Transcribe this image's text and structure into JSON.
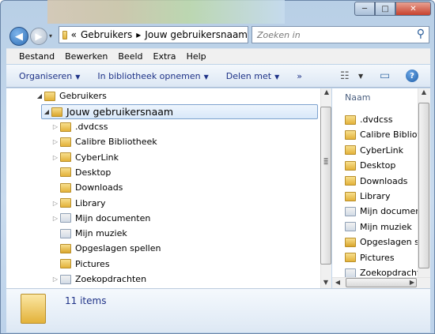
{
  "window": {
    "controls": {
      "minimize": "─",
      "maximize": "□",
      "close": "✕"
    }
  },
  "nav": {
    "back_icon": "◀",
    "forward_icon": "▶",
    "recent_icon": "▾"
  },
  "address": {
    "chevron": "«",
    "crumbs": [
      "Gebruikers",
      "Jouw gebruikersnaam"
    ],
    "separator": "▸"
  },
  "search": {
    "placeholder": "Zoeken in",
    "icon": "search-icon",
    "glyph": "⚲"
  },
  "menu": [
    "Bestand",
    "Bewerken",
    "Beeld",
    "Extra",
    "Help"
  ],
  "commands": {
    "organize": "Organiseren",
    "include": "In bibliotheek opnemen",
    "share": "Delen met",
    "more": "»",
    "view_icon": "☷",
    "pane_icon": "▭",
    "help_icon": "?"
  },
  "tree": {
    "root": "Gebruikers",
    "user": "Jouw gebruikersnaam",
    "children": [
      ".dvdcss",
      "Calibre Bibliotheek",
      "CyberLink",
      "Desktop",
      "Downloads",
      "Library",
      "Mijn documenten",
      "Mijn muziek",
      "Opgeslagen spellen",
      "Pictures",
      "Zoekopdrachten"
    ]
  },
  "list": {
    "header": "Naam",
    "items": [
      ".dvdcss",
      "Calibre Bibliotheek",
      "CyberLink",
      "Desktop",
      "Downloads",
      "Library",
      "Mijn documenten",
      "Mijn muziek",
      "Opgeslagen spellen",
      "Pictures",
      "Zoekopdrachten"
    ]
  },
  "details": {
    "count": "11 items"
  },
  "colors": {
    "accent": "#1e3287",
    "selection": "#d8e8f9"
  }
}
